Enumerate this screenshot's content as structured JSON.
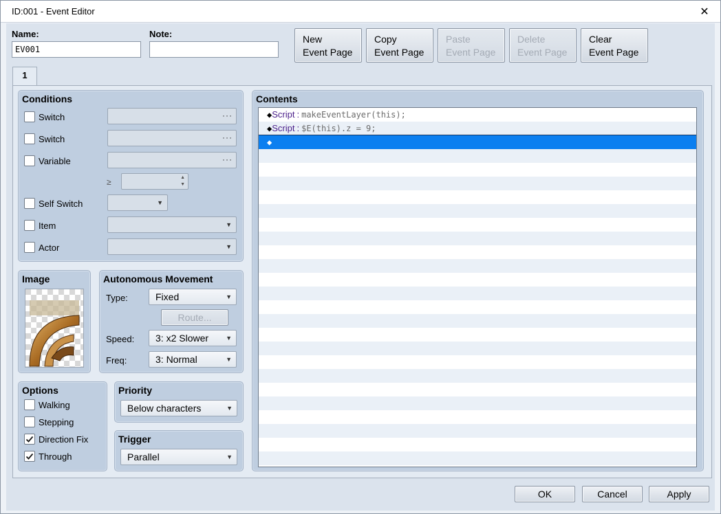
{
  "window": {
    "title": "ID:001 - Event Editor",
    "close_glyph": "✕"
  },
  "fields": {
    "name_label": "Name:",
    "name_value": "EV001",
    "note_label": "Note:",
    "note_value": ""
  },
  "page_buttons": [
    {
      "line1": "New",
      "line2": "Event Page",
      "enabled": true
    },
    {
      "line1": "Copy",
      "line2": "Event Page",
      "enabled": true
    },
    {
      "line1": "Paste",
      "line2": "Event Page",
      "enabled": false
    },
    {
      "line1": "Delete",
      "line2": "Event Page",
      "enabled": false
    },
    {
      "line1": "Clear",
      "line2": "Event Page",
      "enabled": true
    }
  ],
  "tabs": [
    {
      "label": "1"
    }
  ],
  "conditions": {
    "title": "Conditions",
    "switch1": {
      "label": "Switch",
      "checked": false
    },
    "switch2": {
      "label": "Switch",
      "checked": false
    },
    "variable": {
      "label": "Variable",
      "checked": false
    },
    "ge_symbol": "≥",
    "self_switch": {
      "label": "Self Switch",
      "checked": false
    },
    "item": {
      "label": "Item",
      "checked": false
    },
    "actor": {
      "label": "Actor",
      "checked": false
    },
    "ellipsis": "···"
  },
  "image": {
    "title": "Image"
  },
  "autonomous_movement": {
    "title": "Autonomous Movement",
    "type_label": "Type:",
    "type_value": "Fixed",
    "route_button": "Route...",
    "speed_label": "Speed:",
    "speed_value": "3: x2 Slower",
    "freq_label": "Freq:",
    "freq_value": "3: Normal"
  },
  "options": {
    "title": "Options",
    "walking": {
      "label": "Walking",
      "checked": false
    },
    "stepping": {
      "label": "Stepping",
      "checked": false
    },
    "direction_fix": {
      "label": "Direction Fix",
      "checked": true
    },
    "through": {
      "label": "Through",
      "checked": true
    }
  },
  "priority": {
    "title": "Priority",
    "value": "Below characters"
  },
  "trigger": {
    "title": "Trigger",
    "value": "Parallel"
  },
  "contents": {
    "title": "Contents",
    "rows": [
      {
        "command": "Script",
        "separator": ":",
        "argument": "makeEventLayer(this);"
      },
      {
        "command": "Script",
        "separator": ":",
        "argument": "$E(this).z = 9;"
      }
    ]
  },
  "dialog_buttons": {
    "ok": "OK",
    "cancel": "Cancel",
    "apply": "Apply"
  },
  "colors": {
    "selection": "#0b7ff0",
    "command_purple": "#4b1f8b",
    "panel": "#bfcee0"
  }
}
